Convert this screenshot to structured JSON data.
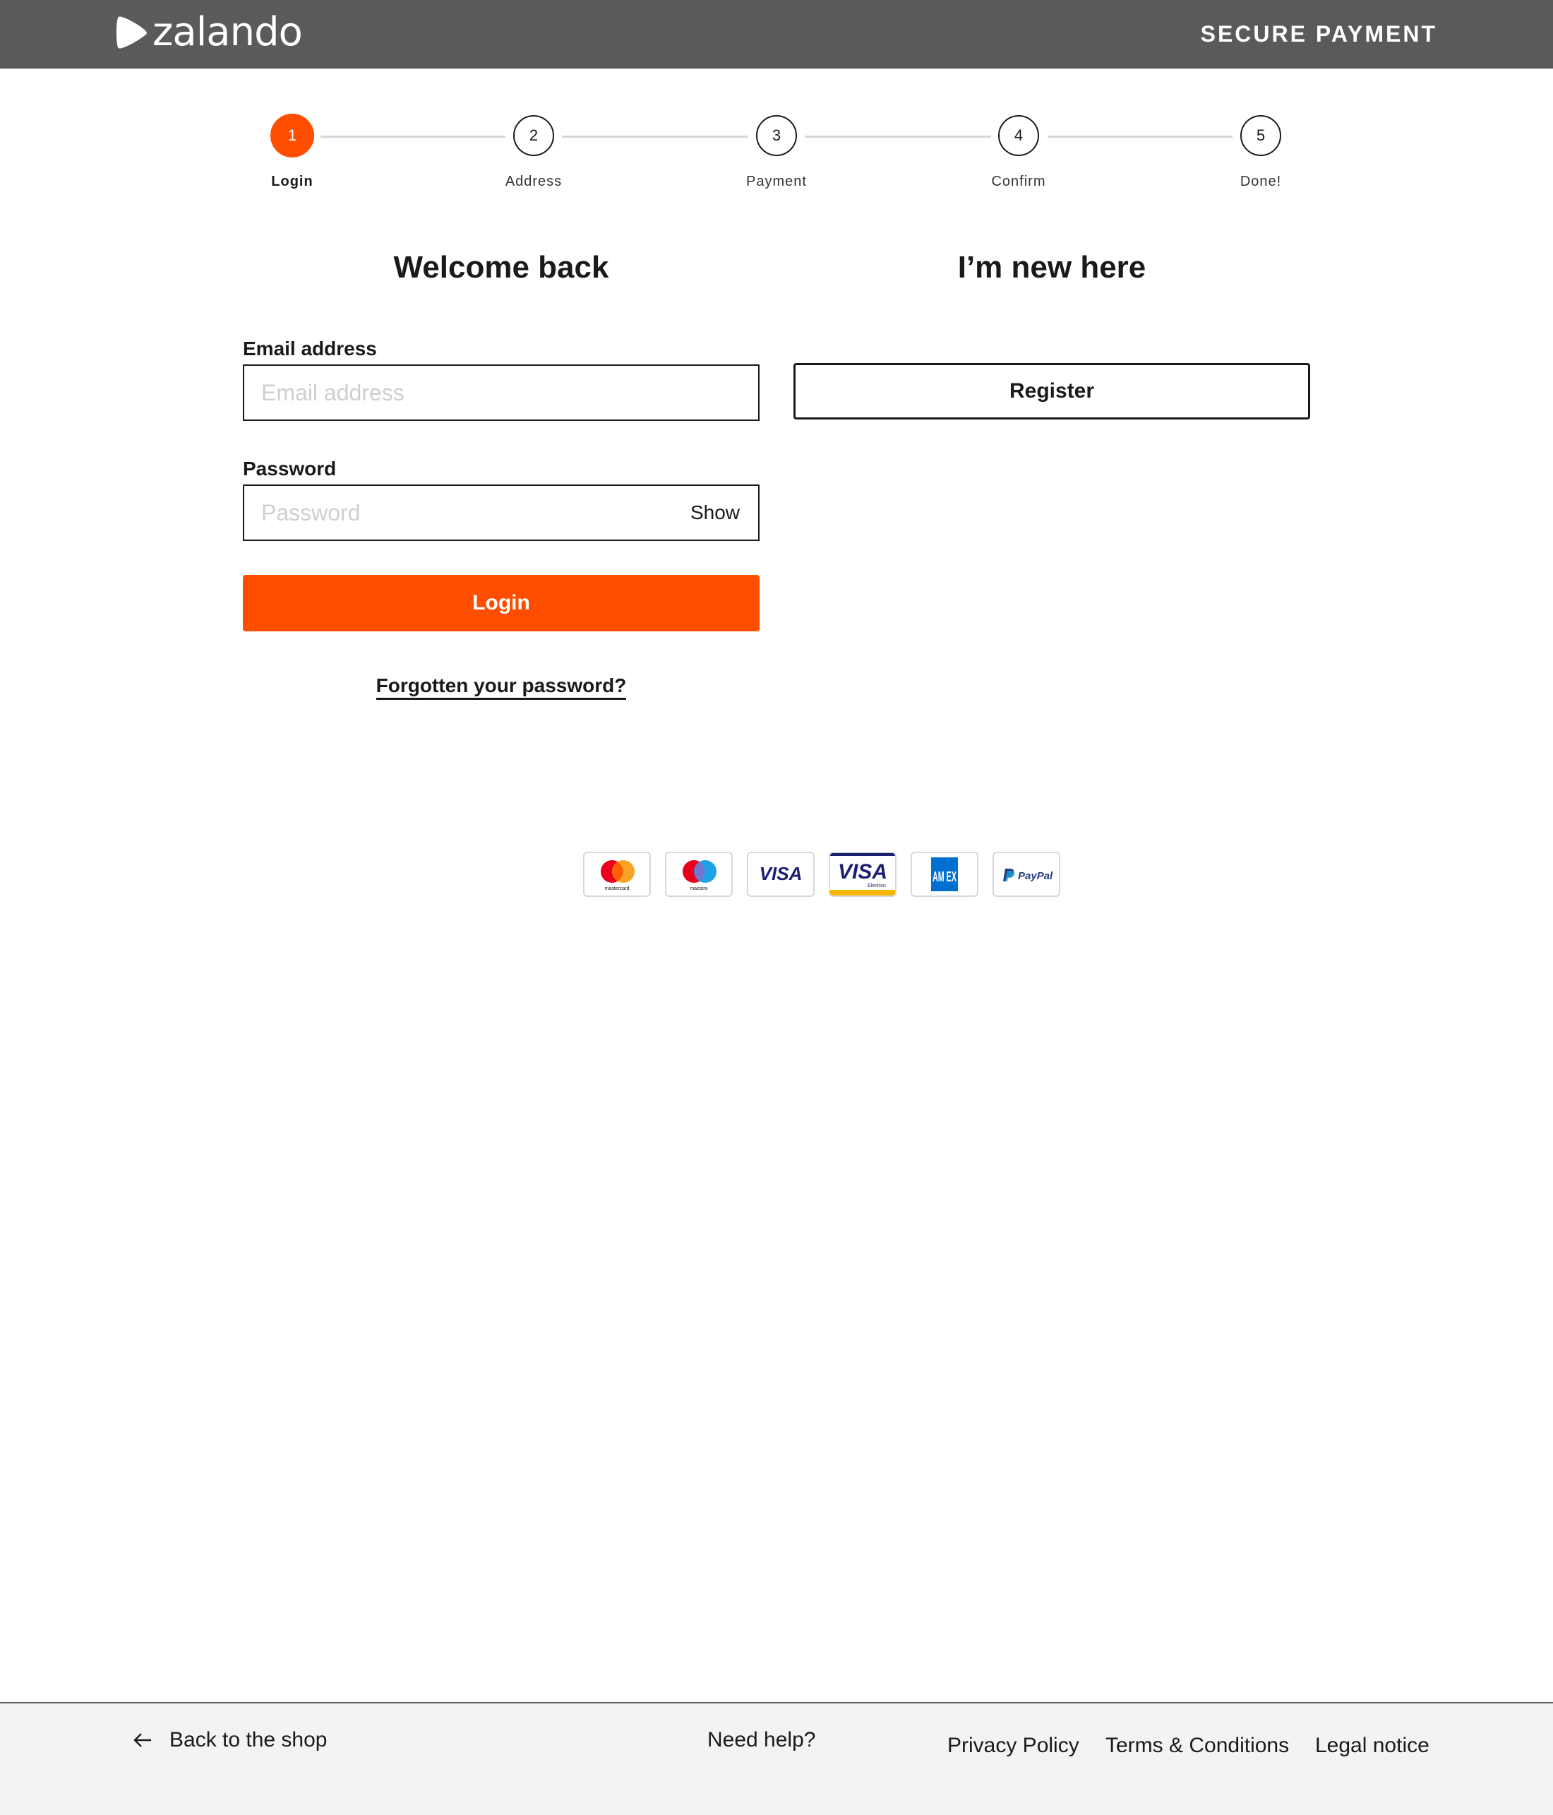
{
  "header": {
    "logo_text": "zalando",
    "secure_label": "SECURE PAYMENT"
  },
  "stepper": {
    "steps": [
      {
        "number": "1",
        "label": "Login",
        "active": true
      },
      {
        "number": "2",
        "label": "Address",
        "active": false
      },
      {
        "number": "3",
        "label": "Payment",
        "active": false
      },
      {
        "number": "4",
        "label": "Confirm",
        "active": false
      },
      {
        "number": "5",
        "label": "Done!",
        "active": false
      }
    ]
  },
  "login": {
    "heading": "Welcome back",
    "email_label": "Email address",
    "email_placeholder": "Email address",
    "email_value": "",
    "password_label": "Password",
    "password_placeholder": "Password",
    "password_value": "",
    "show_label": "Show",
    "login_button": "Login",
    "forgot_link": "Forgotten your password?"
  },
  "register": {
    "heading": "I’m new here",
    "register_button": "Register"
  },
  "payment_methods": [
    {
      "name": "mastercard",
      "label": "mastercard"
    },
    {
      "name": "maestro",
      "label": "maestro"
    },
    {
      "name": "visa",
      "label": "VISA"
    },
    {
      "name": "visa-electron",
      "label": "VISA",
      "sublabel": "Electron"
    },
    {
      "name": "american-express",
      "label": "AM EX"
    },
    {
      "name": "paypal",
      "label": "PayPal"
    }
  ],
  "footer": {
    "back_link": "Back to the shop",
    "help_link": "Need help?",
    "privacy_link": "Privacy Policy",
    "terms_link": "Terms & Conditions",
    "legal_link": "Legal notice"
  },
  "colors": {
    "header_bg": "#5a5a5a",
    "accent": "#ff4e00",
    "footer_bg": "#f3f3f3",
    "text": "#1a1a1a"
  }
}
